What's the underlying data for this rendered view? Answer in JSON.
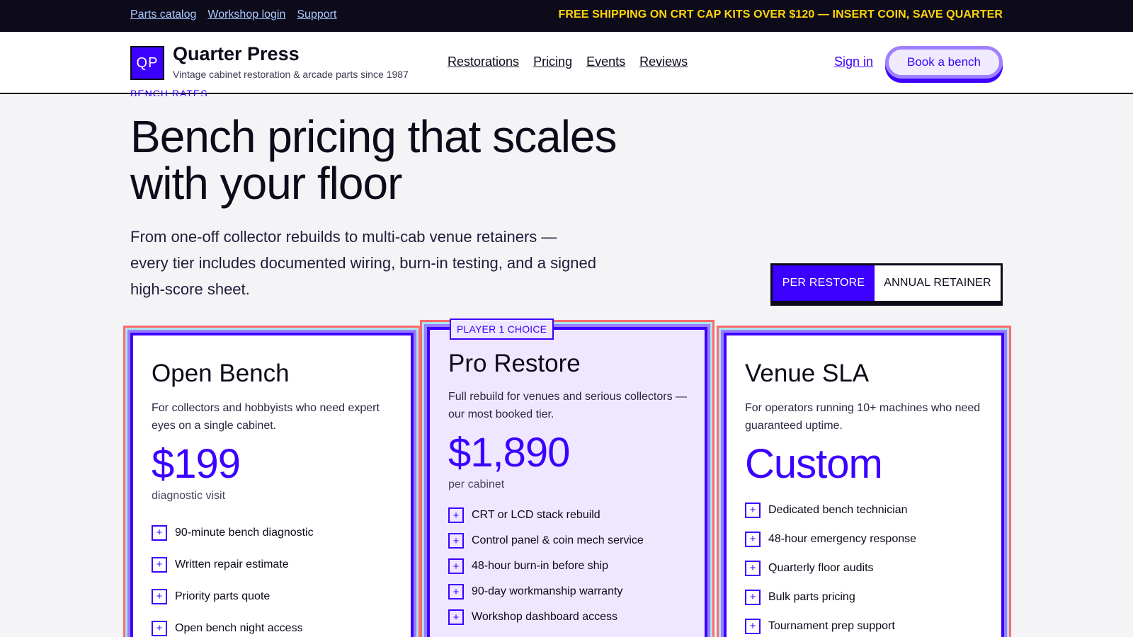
{
  "topbar": {
    "links": [
      "Parts catalog",
      "Workshop login",
      "Support"
    ],
    "promo": "FREE SHIPPING ON CRT CAP KITS OVER $120 — INSERT COIN, SAVE QUARTER"
  },
  "header": {
    "logo_text": "QP",
    "brand_name": "Quarter Press",
    "brand_tagline": "Vintage cabinet restoration & arcade parts since 1987",
    "nav": [
      "Restorations",
      "Pricing",
      "Events",
      "Reviews"
    ],
    "signin_label": "Sign in",
    "cta_label": "Book a bench"
  },
  "hero": {
    "eyebrow": "BENCH RATES",
    "title": "Bench pricing that scales with your floor",
    "subtitle": "From one-off collector rebuilds to multi-cab venue retainers — every tier includes documented wiring, burn-in testing, and a signed high-score sheet."
  },
  "toggle": {
    "options": [
      "PER RESTORE",
      "ANNUAL RETAINER"
    ],
    "selected": "PER RESTORE"
  },
  "plans": [
    {
      "name": "Open Bench",
      "description": "For collectors and hobbyists who need expert eyes on a single cabinet.",
      "price": "$199",
      "unit": "diagnostic visit",
      "features": [
        "90-minute bench diagnostic",
        "Written repair estimate",
        "Priority parts quote",
        "Open bench night access"
      ]
    },
    {
      "badge": "PLAYER 1 CHOICE",
      "name": "Pro Restore",
      "description": "Full rebuild for venues and serious collectors — our most booked tier.",
      "price": "$1,890",
      "unit": "per cabinet",
      "features": [
        "CRT or LCD stack rebuild",
        "Control panel & coin mech service",
        "48-hour burn-in before ship",
        "90-day workmanship warranty",
        "Workshop dashboard access"
      ]
    },
    {
      "name": "Venue SLA",
      "description": "For operators running 10+ machines who need guaranteed uptime.",
      "price": "Custom",
      "features": [
        "Dedicated bench technician",
        "48-hour emergency response",
        "Quarterly floor audits",
        "Bulk parts pricing",
        "Tournament prep support"
      ]
    }
  ],
  "icons": {
    "feature": "plus-icon"
  },
  "colors": {
    "accent": "#3b00ff",
    "promo": "#ffd60a",
    "dark": "#0d0a1a"
  }
}
